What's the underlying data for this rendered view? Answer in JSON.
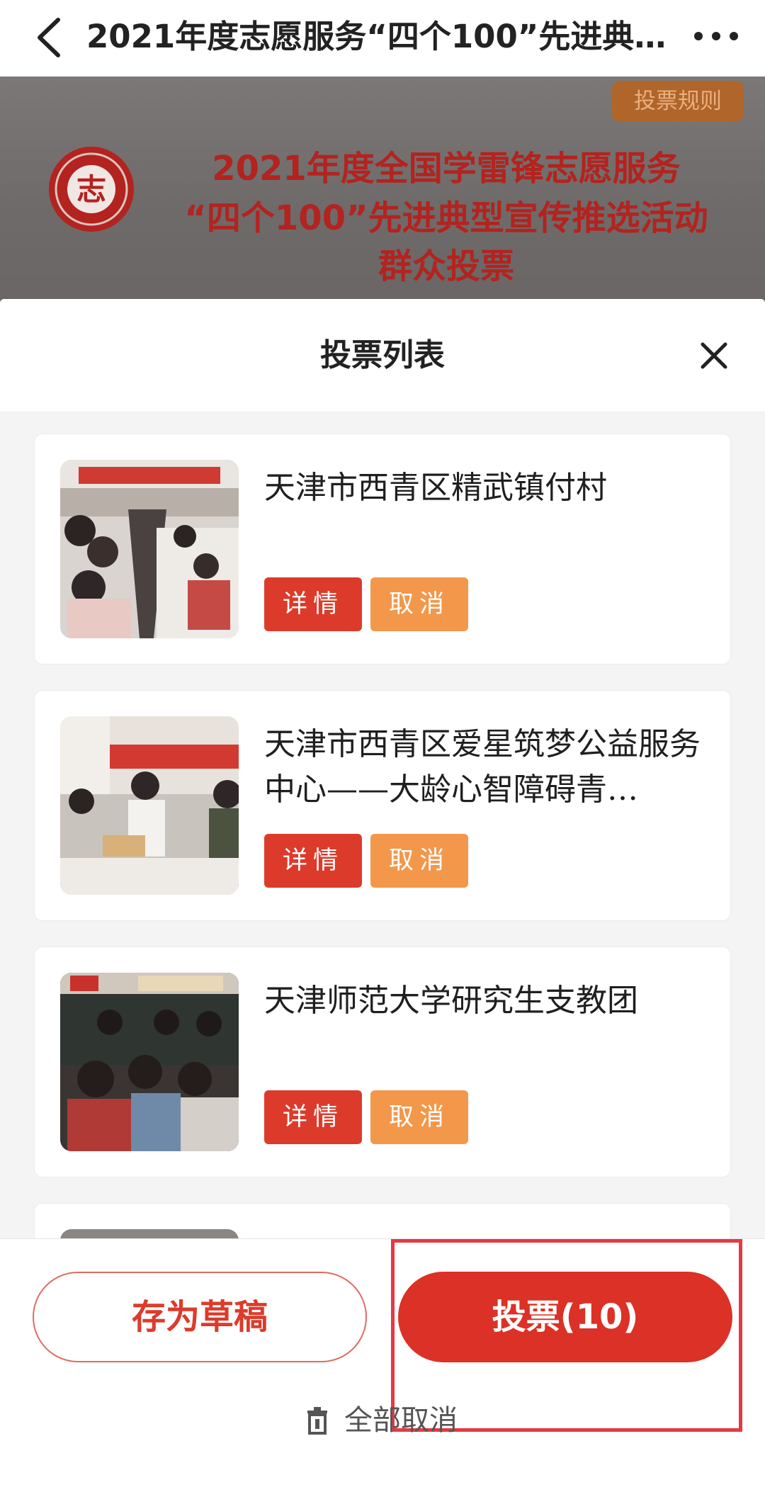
{
  "nav": {
    "title": "2021年度志愿服务“四个100”先进典…"
  },
  "banner": {
    "rules_label": "投票规则",
    "headline_line1": "2021年度全国学雷锋志愿服务",
    "headline_line2": "“四个100”先进典型宣传推选活动",
    "headline_line3": "群众投票",
    "seal_char": "志"
  },
  "panel": {
    "title": "投票列表"
  },
  "items": [
    {
      "title": "天津市西青区精武镇付村",
      "detail_label": "详情",
      "cancel_label": "取消"
    },
    {
      "title": "天津市西青区爱星筑梦公益服务中心——大龄心智障碍青…",
      "detail_label": "详情",
      "cancel_label": "取消"
    },
    {
      "title": "天津师范大学研究生支教团",
      "detail_label": "详情",
      "cancel_label": "取消"
    }
  ],
  "footer": {
    "draft_label": "存为草稿",
    "vote_label": "投票(10)",
    "cancel_all_label": "全部取消"
  },
  "colors": {
    "accent_red": "#dc3b2b",
    "cancel_orange": "#f3974b",
    "banner_text_red": "#b3231f",
    "highlight_red": "#e23a45"
  },
  "icons": [
    "back-arrow-icon",
    "more-dots-icon",
    "close-icon",
    "trash-icon"
  ]
}
